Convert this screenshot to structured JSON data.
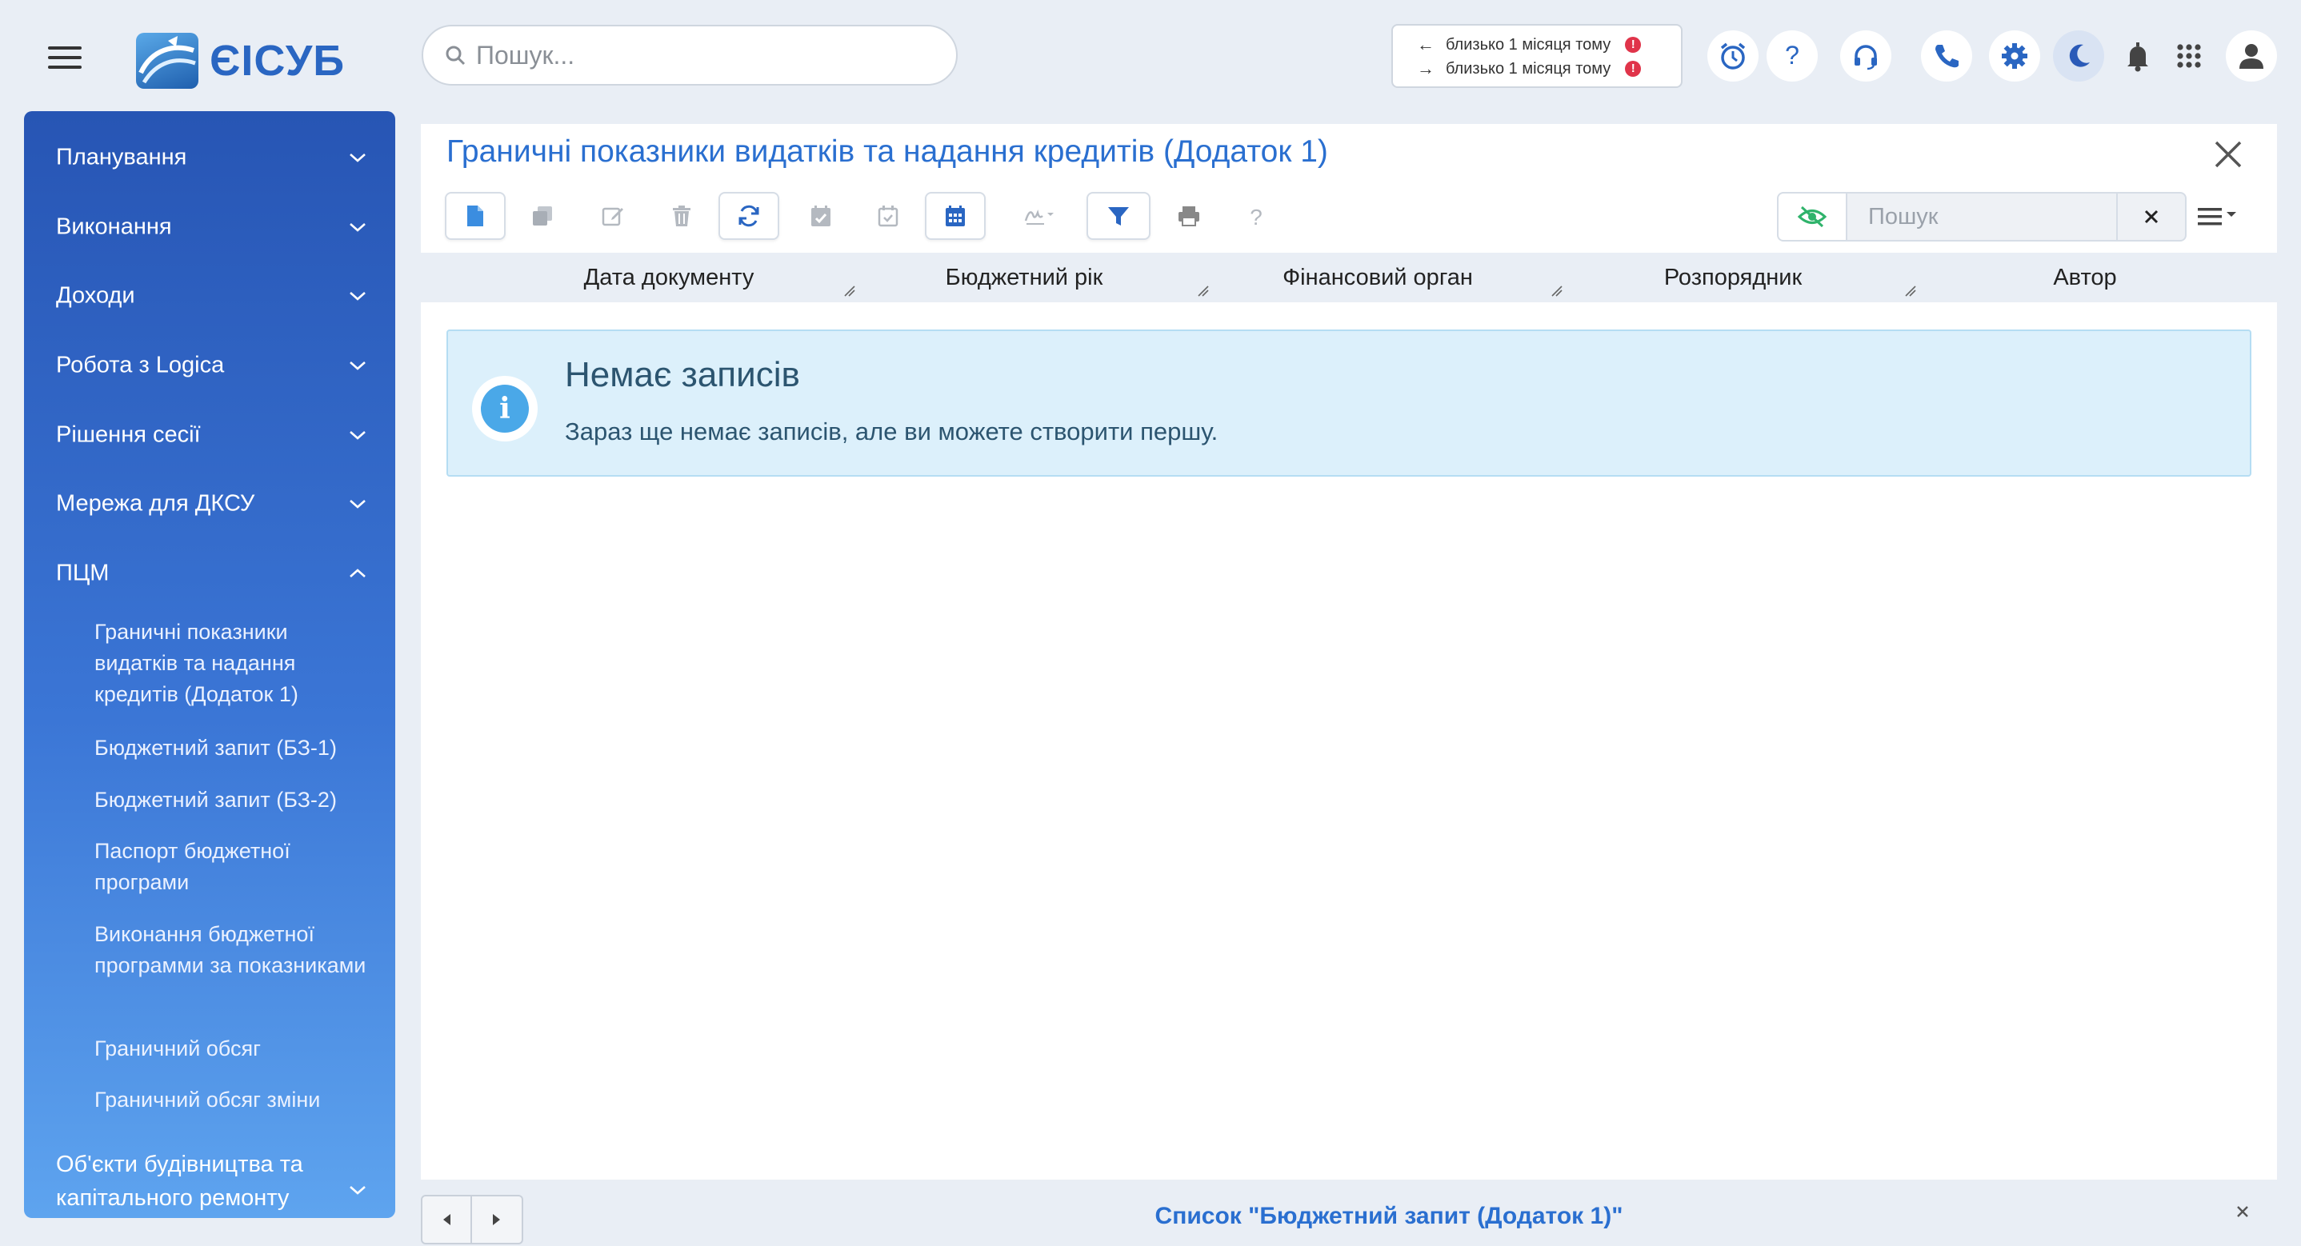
{
  "app": {
    "name": "ЄІСУБ",
    "search_placeholder": "Пошук..."
  },
  "sync": {
    "incoming": "близько 1 місяця тому",
    "outgoing": "близько 1 місяця тому",
    "alert_mark": "!"
  },
  "header_icons": [
    "alarm-clock-icon",
    "help-icon",
    "headset-icon",
    "phone-icon",
    "gear-icon",
    "moon-icon",
    "bell-icon",
    "apps-grid-icon",
    "user-icon"
  ],
  "sidebar": {
    "items": [
      {
        "label": "Планування",
        "expanded": false
      },
      {
        "label": "Виконання",
        "expanded": false
      },
      {
        "label": "Доходи",
        "expanded": false
      },
      {
        "label": "Робота з Logica",
        "expanded": false
      },
      {
        "label": "Рішення сесії",
        "expanded": false
      },
      {
        "label": "Мережа для ДКСУ",
        "expanded": false
      },
      {
        "label": "ПЦМ",
        "expanded": true
      },
      {
        "label": "Об'єкти будівництва та капітального ремонту",
        "expanded": false
      }
    ],
    "subitems": [
      {
        "label": "Граничні показники видатків та надання кредитів (Додаток 1)"
      },
      {
        "label": "Бюджетний запит (БЗ-1)"
      },
      {
        "label": "Бюджетний запит (БЗ-2)"
      },
      {
        "label": "Паспорт бюджетної програми"
      },
      {
        "label": "Виконання бюджетної программи за показниками"
      },
      {
        "label": "Граничний обсяг"
      },
      {
        "label": "Граничний обсяг зміни"
      }
    ]
  },
  "main": {
    "title": "Граничні показники видатків та надання кредитів (Додаток 1)",
    "toolbar": {
      "buttons": [
        "new-document",
        "copy",
        "edit",
        "delete",
        "refresh",
        "calendar-check",
        "calendar-check-outline",
        "calendar",
        "signature",
        "filter",
        "print",
        "help"
      ],
      "search_placeholder": "Пошук",
      "clear_label": "✕"
    },
    "columns": [
      "Дата документу",
      "Бюджетний рік",
      "Фінансовий орган",
      "Розпорядник",
      "Автор"
    ],
    "empty": {
      "title": "Немає записів",
      "text": "Зараз ще немає записів, але ви можете створити першу."
    }
  },
  "bottom": {
    "tab_label": "Список \"Бюджетний запит (Додаток 1)\"",
    "close_label": "×"
  },
  "colors": {
    "accent": "#2a6fd0",
    "sidebar_top": "#2755b4",
    "sidebar_bottom": "#5ea4ef",
    "info_bg": "#dcf0fb",
    "alert": "#e0344a"
  }
}
